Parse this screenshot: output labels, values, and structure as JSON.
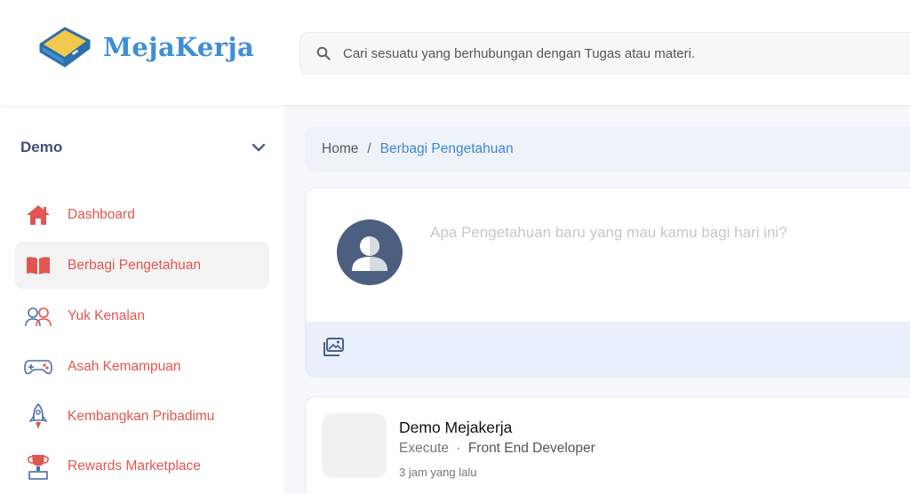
{
  "brand": {
    "name": "MejaKerja",
    "logo_icon": "desk-laptop-logo"
  },
  "search": {
    "placeholder": "Cari sesuatu yang berhubungan dengan Tugas atau materi.",
    "icon": "search-icon"
  },
  "sidebar": {
    "workspace": "Demo",
    "items": [
      {
        "label": "Dashboard",
        "icon": "home-icon",
        "active": false
      },
      {
        "label": "Berbagi Pengetahuan",
        "icon": "open-book-icon",
        "active": true
      },
      {
        "label": "Yuk Kenalan",
        "icon": "people-icon",
        "active": false
      },
      {
        "label": "Asah Kemampuan",
        "icon": "gamepad-icon",
        "active": false
      },
      {
        "label": "Kembangkan Pribadimu",
        "icon": "rocket-icon",
        "active": false
      },
      {
        "label": "Rewards Marketplace",
        "icon": "trophy-icon",
        "active": false
      }
    ]
  },
  "breadcrumb": {
    "home": "Home",
    "separator": "/",
    "current": "Berbagi Pengetahuan"
  },
  "composer": {
    "placeholder": "Apa Pengetahuan baru yang mau kamu bagi hari ini?",
    "attach_icon": "image-gallery-icon"
  },
  "post": {
    "author": "Demo Mejakerja",
    "org": "Execute",
    "dot": "·",
    "role": "Front End Developer",
    "time": "3 jam yang lalu"
  },
  "colors": {
    "accent": "#3f8fd6",
    "nav_label": "#e15651",
    "breadcrumb_bg": "#eef3fa",
    "composer_bar_bg": "#e9f0fb",
    "avatar_bg": "#4d5f7f"
  }
}
